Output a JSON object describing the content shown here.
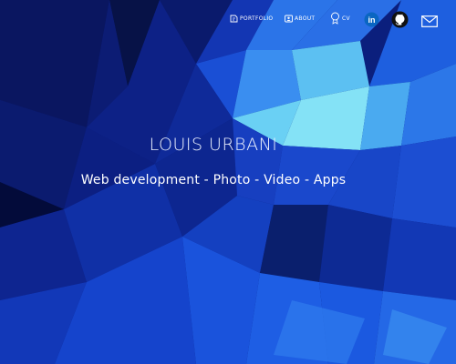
{
  "nav": {
    "portfolio_label": "PORTFOLIO",
    "about_label": "ABOUT",
    "cv_label": "CV",
    "portfolio_icon": "portfolio-icon",
    "about_icon": "person-card-icon",
    "cv_icon": "award-icon",
    "social": [
      {
        "name": "linkedin",
        "label": "in",
        "color": "#0a66c2"
      },
      {
        "name": "github",
        "color": "#111111"
      },
      {
        "name": "email",
        "color": "#ffffff"
      }
    ]
  },
  "hero": {
    "title": "LOUIS URBANI",
    "subtitle": "Web development - Photo - Video - Apps"
  },
  "colors": {
    "bg_deep": "#0a1f7a",
    "bg_bright": "#80e0f5",
    "text": "#ffffff"
  }
}
